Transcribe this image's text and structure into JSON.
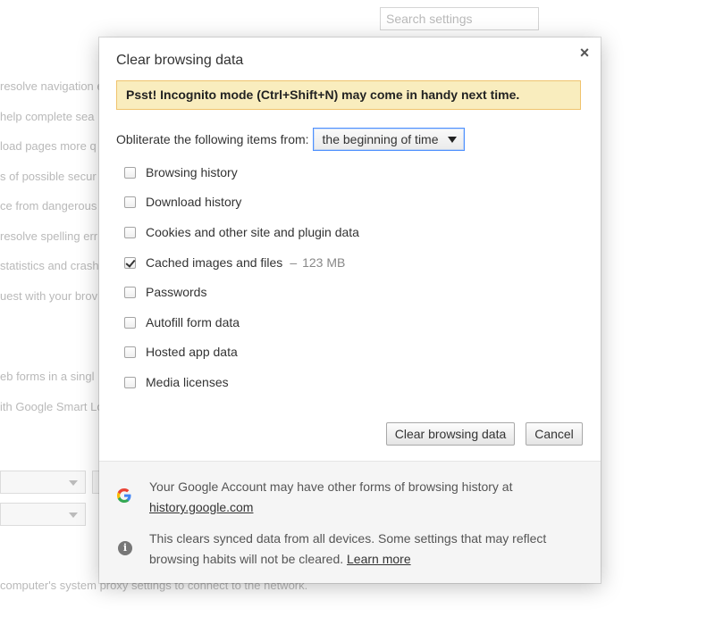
{
  "background": {
    "search_placeholder": "Search settings",
    "lines": [
      "resolve navigation e",
      "help complete sea",
      "load pages more q",
      "s of possible secur",
      "ce from dangerous",
      "resolve spelling err",
      "statistics and crash",
      "uest with your brov",
      "eb forms in a singl",
      "ith Google Smart Lo",
      "computer's system proxy settings to connect to the network."
    ]
  },
  "dialog": {
    "title": "Clear browsing data",
    "close_label": "×",
    "banner": "Psst! Incognito mode (Ctrl+Shift+N) may come in handy next time.",
    "period_label": "Obliterate the following items from:",
    "period_value": "the beginning of time",
    "options": [
      {
        "label": "Browsing history",
        "checked": false
      },
      {
        "label": "Download history",
        "checked": false
      },
      {
        "label": "Cookies and other site and plugin data",
        "checked": false
      },
      {
        "label": "Cached images and files",
        "checked": true,
        "dash": "–",
        "size": "123 MB"
      },
      {
        "label": "Passwords",
        "checked": false
      },
      {
        "label": "Autofill form data",
        "checked": false
      },
      {
        "label": "Hosted app data",
        "checked": false
      },
      {
        "label": "Media licenses",
        "checked": false
      }
    ],
    "clear_button": "Clear browsing data",
    "cancel_button": "Cancel",
    "footer": {
      "account_text": "Your Google Account may have other forms of browsing history at",
      "account_link": "history.google.com",
      "sync_text": "This clears synced data from all devices. Some settings that may reflect browsing habits will not be cleared.",
      "learn_more": "Learn more",
      "google_icon": "G",
      "info_icon": "i"
    }
  }
}
